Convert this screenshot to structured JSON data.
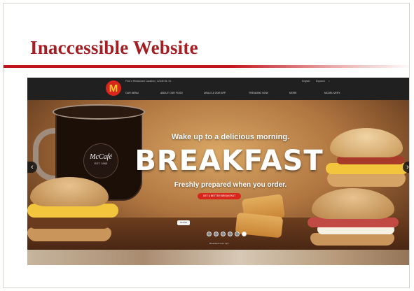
{
  "slide": {
    "title": "Inaccessible Website",
    "title_color": "#a31f22",
    "rule_color": "#c4141b"
  },
  "site": {
    "logo": "M",
    "logo_colors": {
      "background": "#d8261d",
      "glyph": "#ffc72c"
    },
    "utility": {
      "location": "Find a Restaurant Location | 12345 Mt. St.",
      "language": "English",
      "region": "Espanol",
      "search_icon": "search-icon"
    },
    "nav": [
      "OUR MENU",
      "ABOUT OUR FOOD",
      "DEALS & OUR APP",
      "TRENDING NOW",
      "MORE",
      "MCDELIVERY"
    ],
    "hero": {
      "headline": "Wake up to a delicious morning.",
      "title": "BREAKFAST",
      "subhead": "Freshly prepared when you order.",
      "cta": "GET A BETTER BREAKFAST",
      "cta_color": "#d8261d",
      "mccafe_name": "McCafé",
      "mccafe_est": "EST. 1993",
      "pause_label": "PAUSE",
      "prev_icon": "chevron-left-icon",
      "next_icon": "chevron-right-icon",
      "prev_glyph": "‹",
      "next_glyph": "›",
      "caption": "Breakfast hours vary",
      "dots": 6,
      "active_dot": 6
    }
  }
}
